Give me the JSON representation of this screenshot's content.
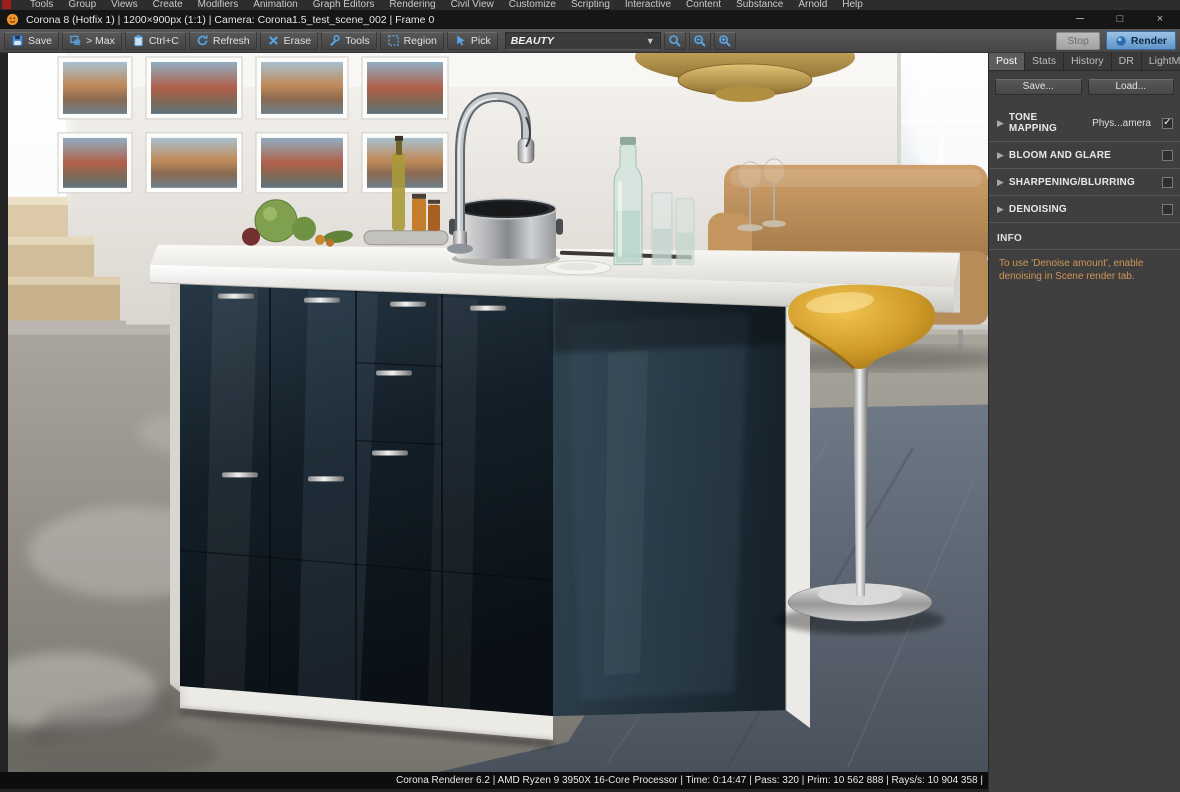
{
  "menubar": {
    "items": [
      "Tools",
      "Group",
      "Views",
      "Create",
      "Modifiers",
      "Animation",
      "Graph Editors",
      "Rendering",
      "Civil View",
      "Customize",
      "Scripting",
      "Interactive",
      "Content",
      "Substance",
      "Arnold",
      "Help"
    ]
  },
  "titlebar": {
    "title": "Corona 8 (Hotfix 1) | 1200×900px (1:1) | Camera: Corona1.5_test_scene_002 | Frame 0",
    "minimize_glyph": "─",
    "maximize_glyph": "□",
    "close_glyph": "×"
  },
  "toolbar": {
    "save": "Save",
    "max": "> Max",
    "copy": "Ctrl+C",
    "refresh": "Refresh",
    "erase": "Erase",
    "tools": "Tools",
    "region": "Region",
    "pick": "Pick",
    "channel": "BEAUTY",
    "dropdown_arrow": "▼",
    "stop": "Stop",
    "render": "Render"
  },
  "panel": {
    "tabs": [
      {
        "label": "Post"
      },
      {
        "label": "Stats"
      },
      {
        "label": "History"
      },
      {
        "label": "DR"
      },
      {
        "label": "LightMix"
      }
    ],
    "save_button": "Save...",
    "load_button": "Load...",
    "arrow": "▶",
    "check_glyph": "✓",
    "sections": [
      {
        "label": "TONE MAPPING",
        "value": "Phys...amera",
        "checked": true
      },
      {
        "label": "BLOOM AND GLARE",
        "checked": false
      },
      {
        "label": "SHARPENING/BLURRING",
        "checked": false
      },
      {
        "label": "DENOISING",
        "checked": false
      }
    ],
    "info_title": "INFO",
    "info_text": "To use 'Denoise amount', enable denoising in Scene render tab."
  },
  "statusbar": {
    "text": "Corona Renderer 6.2 | AMD Ryzen 9 3950X 16-Core Processor  | Time: 0:14:47 | Pass: 320 | Prim: 10 562 888 | Rays/s: 10 904 358 |"
  }
}
